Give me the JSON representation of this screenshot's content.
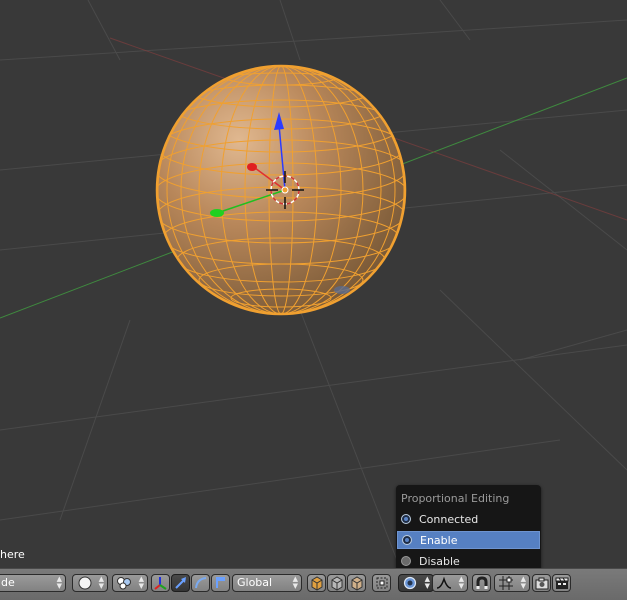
{
  "viewport": {
    "object_label": "here"
  },
  "proportional_menu": {
    "title": "Proportional Editing",
    "items": [
      {
        "label": "Connected"
      },
      {
        "label": "Enable"
      },
      {
        "label": "Disable"
      }
    ]
  },
  "header": {
    "mode_label": "de",
    "orientation_label": "Global"
  },
  "colors": {
    "background": "#393939",
    "mesh": "#f0a030",
    "highlight": "#5680c2",
    "header": "#727272"
  }
}
